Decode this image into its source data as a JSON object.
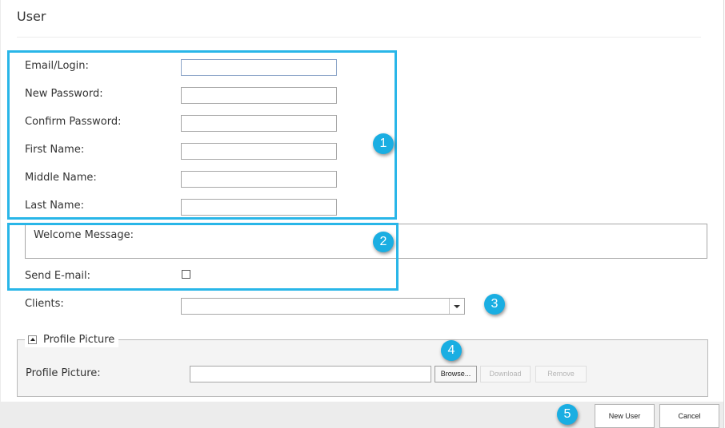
{
  "page": {
    "title": "User"
  },
  "form": {
    "email_label": "Email/Login:",
    "new_password_label": "New Password:",
    "confirm_password_label": "Confirm Password:",
    "first_name_label": "First Name:",
    "middle_name_label": "Middle Name:",
    "last_name_label": "Last Name:",
    "welcome_message_label": "Welcome Message:",
    "send_email_label": "Send E-mail:",
    "send_email_checked": false,
    "clients_label": "Clients:",
    "clients_selected": "",
    "values": {
      "email": "",
      "new_password": "",
      "confirm_password": "",
      "first_name": "",
      "middle_name": "",
      "last_name": ""
    }
  },
  "profile_picture": {
    "legend": "Profile Picture",
    "field_label": "Profile Picture:",
    "file_value": "",
    "browse_label": "Browse...",
    "download_label": "Download",
    "remove_label": "Remove"
  },
  "footer": {
    "new_user_label": "New User",
    "cancel_label": "Cancel"
  },
  "callouts": [
    "1",
    "2",
    "3",
    "4",
    "5"
  ],
  "colors": {
    "highlight": "#29b6e8",
    "badge": "#1aaee2",
    "footer_bg": "#ececec",
    "fieldset_bg": "#f4f4f4"
  }
}
